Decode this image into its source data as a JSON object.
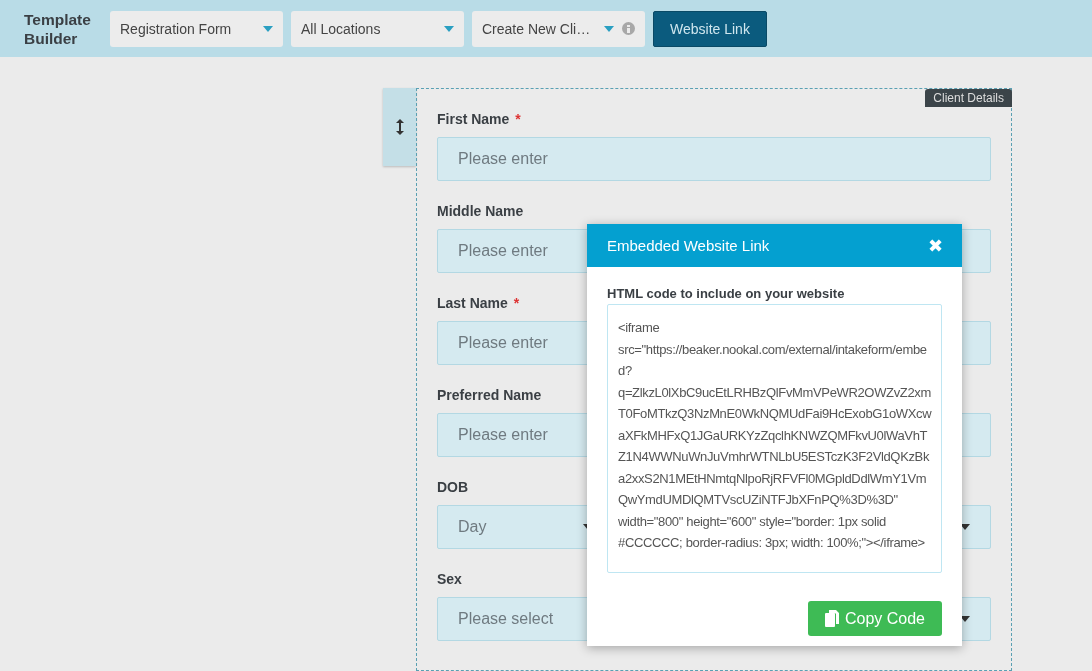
{
  "toolbar": {
    "title": "Template Builder",
    "dropdowns": [
      {
        "value": "Registration Form",
        "info": false
      },
      {
        "value": "All Locations",
        "info": false
      },
      {
        "value": "Create New Cli…",
        "info": true
      }
    ],
    "button": "Website Link"
  },
  "section": {
    "tag": "Client Details",
    "required_mark": "*",
    "fields": [
      {
        "kind": "text",
        "label": "First Name",
        "required": true,
        "placeholder": "Please enter"
      },
      {
        "kind": "text",
        "label": "Middle Name",
        "required": false,
        "placeholder": "Please enter"
      },
      {
        "kind": "text",
        "label": "Last Name",
        "required": true,
        "placeholder": "Please enter"
      },
      {
        "kind": "text",
        "label": "Preferred Name",
        "required": false,
        "placeholder": "Please enter"
      },
      {
        "kind": "date",
        "label": "DOB",
        "required": false,
        "placeholder": "Day"
      },
      {
        "kind": "select",
        "label": "Sex",
        "required": false,
        "placeholder": "Please select"
      }
    ]
  },
  "modal": {
    "title": "Embedded Website Link",
    "close": "✖",
    "label": "HTML code to include on your website",
    "code": "<iframe src=\"https://beaker.nookal.com/external/intakeform/embed?q=ZlkzL0lXbC9ucEtLRHBzQlFvMmVPeWR2OWZvZ2xmT0FoMTkzQ3NzMnE0WkNQMUdFai9HcExobG1oWXcwaXFkMHFxQ1JGaURKYzZqclhKNWZQMFkvU0lWaVhTZ1N4WWNuWnJuVmhrWTNLbU5ESTczK3F2VldQKzBka2xxS2N1MEtHNmtqNlpoRjRFVFl0MGpldDdlWmY1VmQwYmdUMDlQMTVscUZiNTFJbXFnPQ%3D%3D\" width=\"800\" height=\"600\" style=\"border: 1px solid #CCCCCC; border-radius: 3px; width: 100%;\"></iframe>",
    "copy": "Copy Code"
  }
}
